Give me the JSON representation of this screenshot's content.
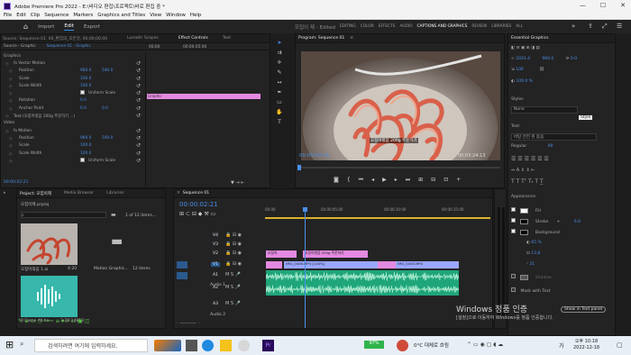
{
  "titlebar": {
    "title": "Adobe Premiere Pro 2022 - E:\\비디오 편집\\프로젝트\\바로 편집 중 *",
    "minimize": "—",
    "maximize": "☐",
    "close": "✕"
  },
  "menu": [
    "File",
    "Edit",
    "Clip",
    "Sequence",
    "Markers",
    "Graphics and Titles",
    "View",
    "Window",
    "Help"
  ],
  "workspace": {
    "tabs": [
      "Import",
      "Edit",
      "Export"
    ],
    "active": "Edit",
    "project_name": "모집이 제 - Edited",
    "modes": [
      "EDITING",
      "COLOR",
      "EFFECTS",
      "AUDIO",
      "CAPTIONS AND GRAPHICS",
      "REVIEW",
      "LIBRARIES",
      "ALL"
    ],
    "active_mode": "CAPTIONS AND GRAPHICS"
  },
  "effect_controls": {
    "tabs": [
      "Source: Sequence 01: 00_편집의_모든것, 00;00;00;00",
      "Lumetri Scopes",
      "Effect Controls",
      "Text"
    ],
    "active_tab": "Effect Controls",
    "source_label": "Source - Graphic",
    "sequence_label": "Sequence 01 - Graphic",
    "time_start": "00;00",
    "time_end": "00:00:05:00",
    "clip_label": "Graphic",
    "sections": [
      {
        "label": "Graphics",
        "level": 0
      },
      {
        "label": "fx  Vector Motion",
        "level": 1
      },
      {
        "label": "Position",
        "level": 2,
        "v1": "960.0",
        "v2": "540.0"
      },
      {
        "label": "Scale",
        "level": 2,
        "v1": "100.0"
      },
      {
        "label": "Scale Width",
        "level": 2,
        "v1": "100.0"
      },
      {
        "label": "Uniform Scale",
        "level": 2,
        "checkbox": true
      },
      {
        "label": "Rotation",
        "level": 2,
        "v1": "0.0"
      },
      {
        "label": "Anchor Point",
        "level": 2,
        "v1": "0.0",
        "v2": "0.0"
      },
      {
        "label": "Text (오징어볶음 200g 주문하기 ...)",
        "level": 1
      },
      {
        "label": "Video",
        "level": 0
      },
      {
        "label": "fx  Motion",
        "level": 1
      },
      {
        "label": "Position",
        "level": 2,
        "v1": "960.0",
        "v2": "540.0"
      },
      {
        "label": "Scale",
        "level": 2,
        "v1": "100.0"
      },
      {
        "label": "Scale Width",
        "level": 2,
        "v1": "100.0"
      },
      {
        "label": "Uniform Scale",
        "level": 2,
        "checkbox": true
      }
    ],
    "timecode": "00:00:02:21"
  },
  "program": {
    "title": "Program: Sequence 01",
    "subtitle": "오징어볶음 200g 주문하기",
    "timecode": "00:00:02:21",
    "fit": "Fit",
    "quality": "Full",
    "duration": "00:03:24:13"
  },
  "tools": [
    "select",
    "track-select",
    "ripple",
    "razor",
    "slip",
    "pen",
    "rectangle",
    "hand",
    "type"
  ],
  "essential_graphics": {
    "title": "Essential Graphics",
    "position_x": "2031.4",
    "position_y": "969.0",
    "scale": "100",
    "rotation": "0.0",
    "opacity": "100.0 %",
    "styles_label": "Styles",
    "style_value": "None",
    "text_label": "Text",
    "font": "바탕 안전 흰 돋음",
    "font_style": "Regular",
    "font_size": "90",
    "appearance_label": "Appearance",
    "fill_label": "Fill",
    "stroke_label": "Stroke",
    "stroke_size": "6.0",
    "background_label": "Background",
    "bg_opacity": "65 %",
    "bg_size": "13.8",
    "bg_corner": "21",
    "shadow_label": "Shadow",
    "mask_label": "Mask with Text",
    "tooltip": "Style",
    "show_in_panel": "Show in Text panel"
  },
  "project": {
    "tabs": [
      "Project: 모집이제",
      "Media Browser",
      "Libraries"
    ],
    "file": "모집이제.prproj",
    "count": "1 of 12 items...",
    "items": [
      {
        "name": "오징어볶음 1.ai",
        "meta": "4:20"
      },
      {
        "name": "Motion Graphic...",
        "meta": "12 items"
      },
      {
        "name": "0 Come All.ha...",
        "meta": "3:29:14813"
      }
    ]
  },
  "timeline": {
    "title": "Sequence 01",
    "timecode": "00:00:02:21",
    "ruler": [
      "00:00",
      "00:00:05:00",
      "00:00:10:00",
      "00:00:15:00"
    ],
    "tracks": [
      "V4",
      "V3",
      "V2",
      "V1",
      "A1",
      "A2",
      "A3"
    ],
    "track_labels": {
      "a1": "Audio 1",
      "a2": "Audio 2"
    },
    "clips": {
      "v3_a": "오징어",
      "v3_b": "오징어볶음 200g 주문하기",
      "v1_a": "IMG_0406.MP4 [100%]",
      "v1_b": "IMG_0405.MP4"
    }
  },
  "watermark": {
    "line1": "Windows 정품 인증",
    "line2": "[설정]으로 이동하여 Windows를 정품 인증합니다."
  },
  "taskbar": {
    "search_placeholder": "검색하려면 여기에 입력하세요.",
    "battery": "97%",
    "weather": "0°C 대체로 흐림",
    "ime": "가",
    "time": "오후 10:18",
    "date": "2022-12-18"
  },
  "colors": {
    "accent": "#2d8ceb",
    "timecode_blue": "#4a8fe8",
    "graphic_clip": "#e48ae0",
    "video_clip": "#9aa7ff",
    "audio_clip": "#1fa57a"
  }
}
